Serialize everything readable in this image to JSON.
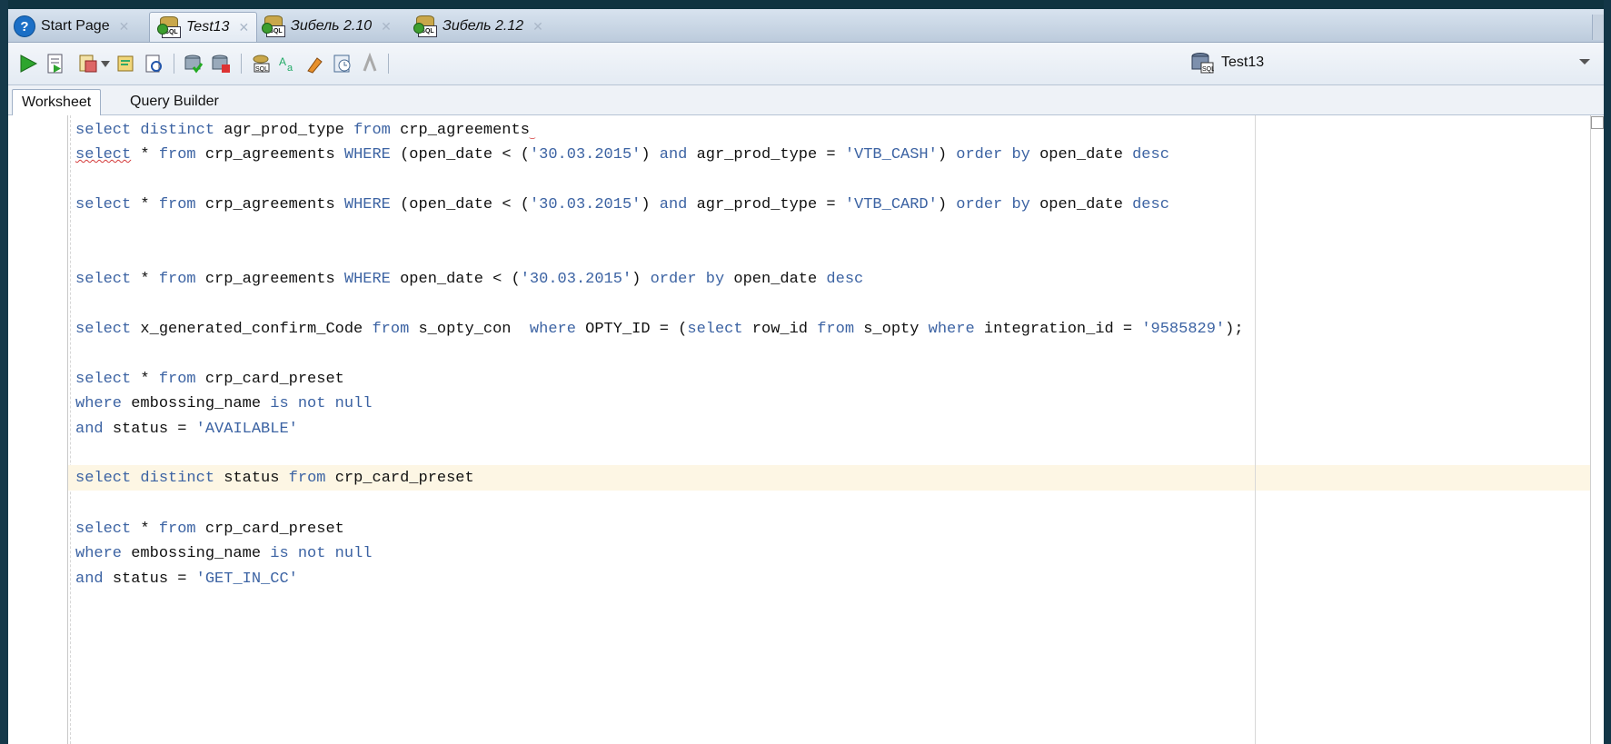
{
  "tabs": [
    {
      "label": "Start Page",
      "icon": "help-icon",
      "italic": false,
      "active": false
    },
    {
      "label": "Test13",
      "icon": "sql-worksheet-icon",
      "italic": true,
      "active": true
    },
    {
      "label": "Зибель 2.10",
      "icon": "sql-worksheet-icon",
      "italic": true,
      "active": false
    },
    {
      "label": "Зибель 2.12",
      "icon": "sql-worksheet-icon",
      "italic": true,
      "active": false
    }
  ],
  "toolbar": {
    "buttons": [
      "run-statement-icon",
      "run-script-icon",
      "autotrace-icon",
      "explain-plan-icon",
      "sql-tuning-icon",
      "commit-icon",
      "rollback-icon",
      "unshared-sql-icon",
      "to-upper-lower-icon",
      "clear-icon",
      "sql-history-icon",
      "format-icon"
    ],
    "connection": "Test13"
  },
  "subtabs": {
    "worksheet": "Worksheet",
    "query_builder": "Query Builder"
  },
  "editor": {
    "lines": [
      "select distinct agr_prod_type from crp_agreements",
      "select * from crp_agreements WHERE (open_date < ('30.03.2015') and agr_prod_type = 'VTB_CASH') order by open_date desc",
      "select * from crp_agreements WHERE (open_date < ('30.03.2015') and agr_prod_type = 'VTB_CARD') order by open_date desc",
      "select * from crp_agreements WHERE open_date < ('30.03.2015') order by open_date desc",
      "select x_generated_confirm_Code from s_opty_con  where OPTY_ID = (select row_id from s_opty where integration_id = '9585829');",
      "select * from crp_card_preset",
      "where embossing_name is not null",
      "and status = 'AVAILABLE'",
      "select distinct status from crp_card_preset",
      "select * from crp_card_preset",
      "where embossing_name is not null",
      "and status = 'GET_IN_CC'"
    ]
  },
  "colors": {
    "keyword": "#3c63a3",
    "identifier": "#111111",
    "current_line": "#fdf6e4"
  }
}
